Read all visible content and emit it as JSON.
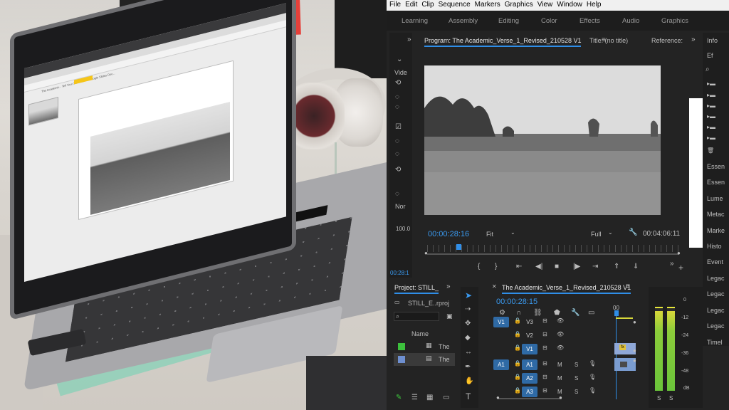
{
  "menu": [
    "File",
    "Edit",
    "Clip",
    "Sequence",
    "Markers",
    "Graphics",
    "View",
    "Window",
    "Help"
  ],
  "workspaces": [
    "Learning",
    "Assembly",
    "Editing",
    "Color",
    "Effects",
    "Audio",
    "Graphics"
  ],
  "left_panel": {
    "labels": [
      "Vide",
      "Nor",
      "100.0",
      "00:28:1"
    ]
  },
  "program_monitor": {
    "tab": "Program: The Academic_Verse_1_Revised_210528 V1",
    "title_tab": "Title: (no title)",
    "reference_tab": "Reference:",
    "timecode_current": "00:00:28:16",
    "fit": "Fit",
    "quality": "Full",
    "timecode_duration": "00:04:06:11"
  },
  "right_panel": {
    "info_tab": "Info",
    "effects_tab": "Ef",
    "items": [
      "Essen",
      "Essen",
      "Lume",
      "Metac",
      "Marke",
      "Histo",
      "Event",
      "Legac",
      "Legac",
      "Legac",
      "Legac",
      "Timel"
    ]
  },
  "project": {
    "tab": "Project: STILL_",
    "file": "STILL_E..rproj",
    "column_name": "Name",
    "rows": [
      "The",
      "The"
    ]
  },
  "timeline": {
    "tab": "The Academic_Verse_1_Revised_210528 V1",
    "timecode": "00:00:28:15",
    "ruler_label": "00",
    "video_tracks": [
      {
        "source": "V1",
        "name": "V3"
      },
      {
        "source": "",
        "name": "V2"
      },
      {
        "source": "",
        "name": "V1"
      }
    ],
    "audio_tracks": [
      {
        "source": "A1",
        "name": "A1"
      },
      {
        "source": "",
        "name": "A2"
      },
      {
        "source": "",
        "name": "A3"
      }
    ],
    "m_label": "M",
    "s_label": "S"
  },
  "audio_meter": {
    "scale": [
      "0",
      "-12",
      "-24",
      "-36",
      "-48",
      "dB"
    ],
    "solo": [
      "S",
      "S"
    ]
  },
  "laptop_screen": {
    "slides_title": "The Academic - Tell Your Summer - 4 Google Slides Doc..."
  }
}
